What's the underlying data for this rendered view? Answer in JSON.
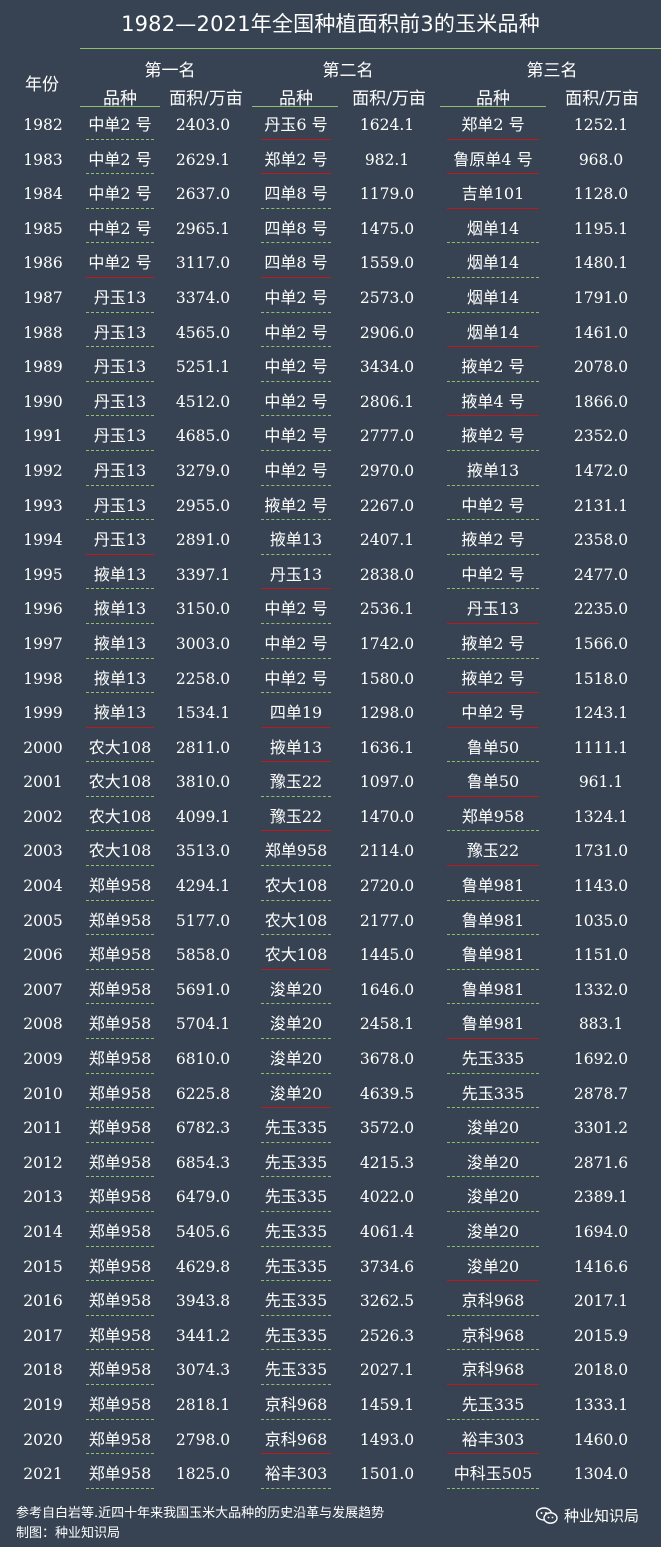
{
  "title": "1982—2021年全国种植面积前3的玉米品种",
  "header": {
    "year": "年份",
    "groups": [
      "第一名",
      "第二名",
      "第三名"
    ],
    "variety": "品种",
    "area": "面积/万亩"
  },
  "colors": {
    "background": "#374352",
    "green": "#8fbf6a",
    "red": "#c0191c"
  },
  "rows": [
    {
      "year": "1982",
      "v1": "中单2 号",
      "a1": "2403.0",
      "u1": "g",
      "v2": "丹玉6 号",
      "a2": "1624.1",
      "u2": "r",
      "v3": "郑单2 号",
      "a3": "1252.1",
      "u3": "r"
    },
    {
      "year": "1983",
      "v1": "中单2 号",
      "a1": "2629.1",
      "u1": "g",
      "v2": "郑单2 号",
      "a2": "982.1",
      "u2": "r",
      "v3": "鲁原单4 号",
      "a3": "968.0",
      "u3": "r"
    },
    {
      "year": "1984",
      "v1": "中单2 号",
      "a1": "2637.0",
      "u1": "g",
      "v2": "四单8 号",
      "a2": "1179.0",
      "u2": "g",
      "v3": "吉单101",
      "a3": "1128.0",
      "u3": "r"
    },
    {
      "year": "1985",
      "v1": "中单2 号",
      "a1": "2965.1",
      "u1": "g",
      "v2": "四单8 号",
      "a2": "1475.0",
      "u2": "g",
      "v3": "烟单14",
      "a3": "1195.1",
      "u3": "g"
    },
    {
      "year": "1986",
      "v1": "中单2 号",
      "a1": "3117.0",
      "u1": "r",
      "v2": "四单8 号",
      "a2": "1559.0",
      "u2": "r",
      "v3": "烟单14",
      "a3": "1480.1",
      "u3": "g"
    },
    {
      "year": "1987",
      "v1": "丹玉13",
      "a1": "3374.0",
      "u1": "g",
      "v2": "中单2 号",
      "a2": "2573.0",
      "u2": "g",
      "v3": "烟单14",
      "a3": "1791.0",
      "u3": "g"
    },
    {
      "year": "1988",
      "v1": "丹玉13",
      "a1": "4565.0",
      "u1": "g",
      "v2": "中单2 号",
      "a2": "2906.0",
      "u2": "g",
      "v3": "烟单14",
      "a3": "1461.0",
      "u3": "r"
    },
    {
      "year": "1989",
      "v1": "丹玉13",
      "a1": "5251.1",
      "u1": "g",
      "v2": "中单2 号",
      "a2": "3434.0",
      "u2": "g",
      "v3": "掖单2 号",
      "a3": "2078.0",
      "u3": "g"
    },
    {
      "year": "1990",
      "v1": "丹玉13",
      "a1": "4512.0",
      "u1": "g",
      "v2": "中单2 号",
      "a2": "2806.1",
      "u2": "g",
      "v3": "掖单4 号",
      "a3": "1866.0",
      "u3": "r"
    },
    {
      "year": "1991",
      "v1": "丹玉13",
      "a1": "4685.0",
      "u1": "g",
      "v2": "中单2 号",
      "a2": "2777.0",
      "u2": "g",
      "v3": "掖单2 号",
      "a3": "2352.0",
      "u3": "g"
    },
    {
      "year": "1992",
      "v1": "丹玉13",
      "a1": "3279.0",
      "u1": "g",
      "v2": "中单2 号",
      "a2": "2970.0",
      "u2": "g",
      "v3": "掖单13",
      "a3": "1472.0",
      "u3": "g"
    },
    {
      "year": "1993",
      "v1": "丹玉13",
      "a1": "2955.0",
      "u1": "g",
      "v2": "掖单2 号",
      "a2": "2267.0",
      "u2": "g",
      "v3": "中单2 号",
      "a3": "2131.1",
      "u3": "g"
    },
    {
      "year": "1994",
      "v1": "丹玉13",
      "a1": "2891.0",
      "u1": "r",
      "v2": "掖单13",
      "a2": "2407.1",
      "u2": "g",
      "v3": "掖单2 号",
      "a3": "2358.0",
      "u3": "g"
    },
    {
      "year": "1995",
      "v1": "掖单13",
      "a1": "3397.1",
      "u1": "g",
      "v2": "丹玉13",
      "a2": "2838.0",
      "u2": "r",
      "v3": "中单2 号",
      "a3": "2477.0",
      "u3": "g"
    },
    {
      "year": "1996",
      "v1": "掖单13",
      "a1": "3150.0",
      "u1": "g",
      "v2": "中单2 号",
      "a2": "2536.1",
      "u2": "g",
      "v3": "丹玉13",
      "a3": "2235.0",
      "u3": "r"
    },
    {
      "year": "1997",
      "v1": "掖单13",
      "a1": "3003.0",
      "u1": "g",
      "v2": "中单2 号",
      "a2": "1742.0",
      "u2": "g",
      "v3": "掖单2 号",
      "a3": "1566.0",
      "u3": "g"
    },
    {
      "year": "1998",
      "v1": "掖单13",
      "a1": "2258.0",
      "u1": "g",
      "v2": "中单2 号",
      "a2": "1580.0",
      "u2": "g",
      "v3": "掖单2 号",
      "a3": "1518.0",
      "u3": "r"
    },
    {
      "year": "1999",
      "v1": "掖单13",
      "a1": "1534.1",
      "u1": "r",
      "v2": "四单19",
      "a2": "1298.0",
      "u2": "r",
      "v3": "中单2 号",
      "a3": "1243.1",
      "u3": "r"
    },
    {
      "year": "2000",
      "v1": "农大108",
      "a1": "2811.0",
      "u1": "g",
      "v2": "掖单13",
      "a2": "1636.1",
      "u2": "r",
      "v3": "鲁单50",
      "a3": "1111.1",
      "u3": "g"
    },
    {
      "year": "2001",
      "v1": "农大108",
      "a1": "3810.0",
      "u1": "g",
      "v2": "豫玉22",
      "a2": "1097.0",
      "u2": "g",
      "v3": "鲁单50",
      "a3": "961.1",
      "u3": "r"
    },
    {
      "year": "2002",
      "v1": "农大108",
      "a1": "4099.1",
      "u1": "g",
      "v2": "豫玉22",
      "a2": "1470.0",
      "u2": "r",
      "v3": "郑单958",
      "a3": "1324.1",
      "u3": "g"
    },
    {
      "year": "2003",
      "v1": "农大108",
      "a1": "3513.0",
      "u1": "g",
      "v2": "郑单958",
      "a2": "2114.0",
      "u2": "g",
      "v3": "豫玉22",
      "a3": "1731.0",
      "u3": "r"
    },
    {
      "year": "2004",
      "v1": "郑单958",
      "a1": "4294.1",
      "u1": "g",
      "v2": "农大108",
      "a2": "2720.0",
      "u2": "g",
      "v3": "鲁单981",
      "a3": "1143.0",
      "u3": "g"
    },
    {
      "year": "2005",
      "v1": "郑单958",
      "a1": "5177.0",
      "u1": "g",
      "v2": "农大108",
      "a2": "2177.0",
      "u2": "g",
      "v3": "鲁单981",
      "a3": "1035.0",
      "u3": "g"
    },
    {
      "year": "2006",
      "v1": "郑单958",
      "a1": "5858.0",
      "u1": "g",
      "v2": "农大108",
      "a2": "1445.0",
      "u2": "r",
      "v3": "鲁单981",
      "a3": "1151.0",
      "u3": "g"
    },
    {
      "year": "2007",
      "v1": "郑单958",
      "a1": "5691.0",
      "u1": "g",
      "v2": "浚单20",
      "a2": "1646.0",
      "u2": "g",
      "v3": "鲁单981",
      "a3": "1332.0",
      "u3": "g"
    },
    {
      "year": "2008",
      "v1": "郑单958",
      "a1": "5704.1",
      "u1": "g",
      "v2": "浚单20",
      "a2": "2458.1",
      "u2": "g",
      "v3": "鲁单981",
      "a3": "883.1",
      "u3": "r"
    },
    {
      "year": "2009",
      "v1": "郑单958",
      "a1": "6810.0",
      "u1": "g",
      "v2": "浚单20",
      "a2": "3678.0",
      "u2": "g",
      "v3": "先玉335",
      "a3": "1692.0",
      "u3": "g"
    },
    {
      "year": "2010",
      "v1": "郑单958",
      "a1": "6225.8",
      "u1": "g",
      "v2": "浚单20",
      "a2": "4639.5",
      "u2": "r",
      "v3": "先玉335",
      "a3": "2878.7",
      "u3": "g"
    },
    {
      "year": "2011",
      "v1": "郑单958",
      "a1": "6782.3",
      "u1": "g",
      "v2": "先玉335",
      "a2": "3572.0",
      "u2": "g",
      "v3": "浚单20",
      "a3": "3301.2",
      "u3": "g"
    },
    {
      "year": "2012",
      "v1": "郑单958",
      "a1": "6854.3",
      "u1": "g",
      "v2": "先玉335",
      "a2": "4215.3",
      "u2": "g",
      "v3": "浚单20",
      "a3": "2871.6",
      "u3": "g"
    },
    {
      "year": "2013",
      "v1": "郑单958",
      "a1": "6479.0",
      "u1": "g",
      "v2": "先玉335",
      "a2": "4022.0",
      "u2": "g",
      "v3": "浚单20",
      "a3": "2389.1",
      "u3": "g"
    },
    {
      "year": "2014",
      "v1": "郑单958",
      "a1": "5405.6",
      "u1": "g",
      "v2": "先玉335",
      "a2": "4061.4",
      "u2": "g",
      "v3": "浚单20",
      "a3": "1694.0",
      "u3": "g"
    },
    {
      "year": "2015",
      "v1": "郑单958",
      "a1": "4629.8",
      "u1": "g",
      "v2": "先玉335",
      "a2": "3734.6",
      "u2": "g",
      "v3": "浚单20",
      "a3": "1416.6",
      "u3": "r"
    },
    {
      "year": "2016",
      "v1": "郑单958",
      "a1": "3943.8",
      "u1": "g",
      "v2": "先玉335",
      "a2": "3262.5",
      "u2": "g",
      "v3": "京科968",
      "a3": "2017.1",
      "u3": "g"
    },
    {
      "year": "2017",
      "v1": "郑单958",
      "a1": "3441.2",
      "u1": "g",
      "v2": "先玉335",
      "a2": "2526.3",
      "u2": "g",
      "v3": "京科968",
      "a3": "2015.9",
      "u3": "g"
    },
    {
      "year": "2018",
      "v1": "郑单958",
      "a1": "3074.3",
      "u1": "g",
      "v2": "先玉335",
      "a2": "2027.1",
      "u2": "g",
      "v3": "京科968",
      "a3": "2018.0",
      "u3": "r"
    },
    {
      "year": "2019",
      "v1": "郑单958",
      "a1": "2818.1",
      "u1": "g",
      "v2": "京科968",
      "a2": "1459.1",
      "u2": "g",
      "v3": "先玉335",
      "a3": "1333.1",
      "u3": "g"
    },
    {
      "year": "2020",
      "v1": "郑单958",
      "a1": "2798.0",
      "u1": "g",
      "v2": "京科968",
      "a2": "1493.0",
      "u2": "r",
      "v3": "裕丰303",
      "a3": "1460.0",
      "u3": "r"
    },
    {
      "year": "2021",
      "v1": "郑单958",
      "a1": "1825.0",
      "u1": "g",
      "v2": "裕丰303",
      "a2": "1501.0",
      "u2": "g",
      "v3": "中科玉505",
      "a3": "1304.0",
      "u3": "g"
    }
  ],
  "footer": {
    "source": "参考自白岩等.近四十年来我国玉米大品种的历史沿革与发展趋势",
    "credit": "制图：种业知识局",
    "brand": "种业知识局",
    "brand_icon": "wechat-icon"
  }
}
